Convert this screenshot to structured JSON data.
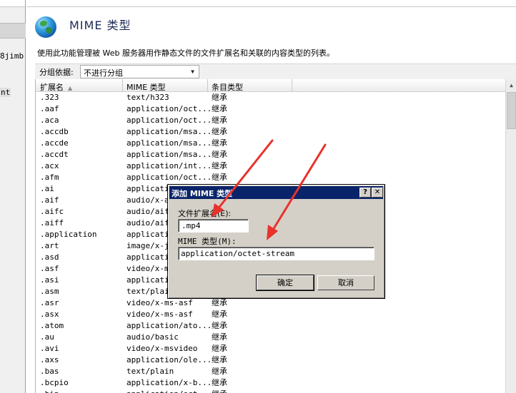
{
  "left_panel": {
    "fragment_1": "8jimb",
    "fragment_2": "nt"
  },
  "header": {
    "title": "MIME 类型",
    "description": "使用此功能管理被 Web 服务器用作静态文件的文件扩展名和关联的内容类型的列表。"
  },
  "group_by": {
    "label": "分组依据:",
    "value": "不进行分组"
  },
  "columns": [
    "扩展名",
    "MIME 类型",
    "条目类型"
  ],
  "rows": [
    {
      "ext": ".323",
      "mime": "text/h323",
      "type": "继承"
    },
    {
      "ext": ".aaf",
      "mime": "application/oct...",
      "type": "继承"
    },
    {
      "ext": ".aca",
      "mime": "application/oct...",
      "type": "继承"
    },
    {
      "ext": ".accdb",
      "mime": "application/msa...",
      "type": "继承"
    },
    {
      "ext": ".accde",
      "mime": "application/msa...",
      "type": "继承"
    },
    {
      "ext": ".accdt",
      "mime": "application/msa...",
      "type": "继承"
    },
    {
      "ext": ".acx",
      "mime": "application/int...",
      "type": "继承"
    },
    {
      "ext": ".afm",
      "mime": "application/oct...",
      "type": "继承"
    },
    {
      "ext": ".ai",
      "mime": "applicati",
      "type": ""
    },
    {
      "ext": ".aif",
      "mime": "audio/x-ai",
      "type": ""
    },
    {
      "ext": ".aifc",
      "mime": "audio/aiff",
      "type": ""
    },
    {
      "ext": ".aiff",
      "mime": "audio/aiff",
      "type": ""
    },
    {
      "ext": ".application",
      "mime": "applicati",
      "type": ""
    },
    {
      "ext": ".art",
      "mime": "image/x-j",
      "type": ""
    },
    {
      "ext": ".asd",
      "mime": "applicati",
      "type": ""
    },
    {
      "ext": ".asf",
      "mime": "video/x-ms",
      "type": ""
    },
    {
      "ext": ".asi",
      "mime": "applicati",
      "type": ""
    },
    {
      "ext": ".asm",
      "mime": "text/plain",
      "type": ""
    },
    {
      "ext": ".asr",
      "mime": "video/x-ms-asf",
      "type": "继承"
    },
    {
      "ext": ".asx",
      "mime": "video/x-ms-asf",
      "type": "继承"
    },
    {
      "ext": ".atom",
      "mime": "application/ato...",
      "type": "继承"
    },
    {
      "ext": ".au",
      "mime": "audio/basic",
      "type": "继承"
    },
    {
      "ext": ".avi",
      "mime": "video/x-msvideo",
      "type": "继承"
    },
    {
      "ext": ".axs",
      "mime": "application/ole...",
      "type": "继承"
    },
    {
      "ext": ".bas",
      "mime": "text/plain",
      "type": "继承"
    },
    {
      "ext": ".bcpio",
      "mime": "application/x-b...",
      "type": "继承"
    },
    {
      "ext": ".bin",
      "mime": "application/oct...",
      "type": "继承"
    }
  ],
  "dialog": {
    "title": "添加 MIME 类型",
    "help_button": "?",
    "close_button": "✕",
    "ext_label": "文件扩展名(E):",
    "ext_value": ".mp4",
    "mime_label": "MIME 类型(M):",
    "mime_value": "application/octet-stream",
    "ok_label": "确定",
    "cancel_label": "取消"
  },
  "colors": {
    "dialog_title_bar": "#0a246a",
    "annotation_arrow": "#e8322b"
  },
  "icons": {
    "header_icon": "globe-icon",
    "sort_indicator": "sort-ascending-icon",
    "dropdown": "chevron-down-icon",
    "annotations": "red-arrow-icon"
  }
}
